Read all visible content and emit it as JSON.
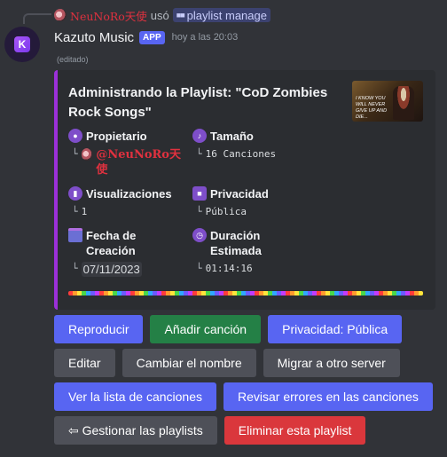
{
  "reply": {
    "user": "NeuNoRo天使",
    "used_text": "usó",
    "command": "playlist manage",
    "command_icon": "slash-command-icon"
  },
  "message": {
    "username": "Kazuto Music",
    "badge": "APP",
    "timestamp": "hoy a las 20:03",
    "edited": "(editado)"
  },
  "embed": {
    "accent_color": "#9b30d9",
    "title": "Administrando la Playlist: \"CoD Zombies Rock Songs\"",
    "thumbnail_text": "I know you will never give up and die...",
    "fields": {
      "owner": {
        "name": "Propietario",
        "tree": "└",
        "value": "@NeuNoRo天使"
      },
      "size": {
        "name": "Tamaño",
        "tree": "└",
        "value": "16 Canciones"
      },
      "views": {
        "name": "Visualizaciones",
        "tree": "└",
        "value": "1"
      },
      "privacy": {
        "name": "Privacidad",
        "tree": "└",
        "value": "Pública"
      },
      "created": {
        "name": "Fecha de Creación",
        "tree": "└",
        "value": "07/11/2023"
      },
      "duration": {
        "name": "Duración Estimada",
        "tree": "└",
        "value": "01:14:16"
      }
    }
  },
  "buttons": {
    "row1": [
      "Reproducir",
      "Añadir canción",
      "Privacidad: Pública"
    ],
    "row2": [
      "Editar",
      "Cambiar el nombre",
      "Migrar a otro server"
    ],
    "row3": [
      "Ver la lista de canciones",
      "Revisar errores en las canciones"
    ],
    "row4": [
      "⇦ Gestionar las playlists",
      "Eliminar esta playlist"
    ]
  }
}
